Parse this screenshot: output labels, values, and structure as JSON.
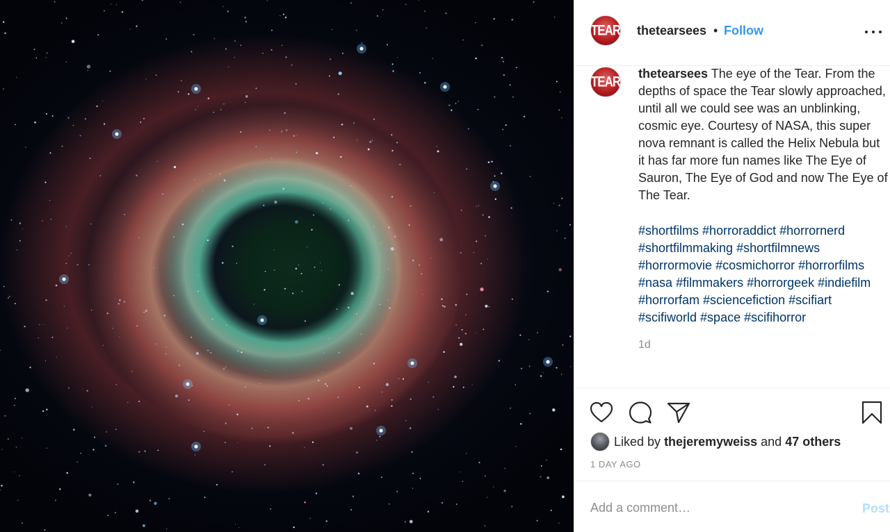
{
  "media": {
    "icon": "nebula-image"
  },
  "header": {
    "avatar_text": "TEAR",
    "username": "thetearsees",
    "separator": "•",
    "follow_label": "Follow",
    "more_icon": "ellipsis-icon"
  },
  "caption": {
    "avatar_text": "TEAR",
    "username": "thetearsees",
    "text": "The eye of the Tear. From the depths of space the Tear slowly approached, until all we could see was an unblinking, cosmic eye. Courtesy of NASA, this super nova remnant is called the Helix Nebula but it has far more fun names like The Eye of Sauron, The Eye of God and now The Eye of The Tear.",
    "hashtags": [
      "#shortfilms",
      "#horroraddict",
      "#horrornerd",
      "#shortfilmmaking",
      "#shortfilmnews",
      "#horrormovie",
      "#cosmichorror",
      "#horrorfilms",
      "#nasa",
      "#filmmakers",
      "#horrorgeek",
      "#indiefilm",
      "#horrorfam",
      "#sciencefiction",
      "#scifiart",
      "#scifiworld",
      "#space",
      "#scifihorror"
    ],
    "time_short": "1d"
  },
  "actions": {
    "like_icon": "heart-icon",
    "comment_icon": "comment-icon",
    "share_icon": "paper-plane-icon",
    "save_icon": "bookmark-icon"
  },
  "likes": {
    "prefix": "Liked by",
    "user": "thejeremyweiss",
    "and": "and",
    "others": "47 others"
  },
  "time_long": "1 DAY AGO",
  "comment": {
    "placeholder": "Add a comment…",
    "post_label": "Post"
  },
  "colors": {
    "link_blue": "#3897f0",
    "hashtag": "#003569",
    "muted": "#8e8e8e",
    "post_disabled": "#b2dffc"
  }
}
